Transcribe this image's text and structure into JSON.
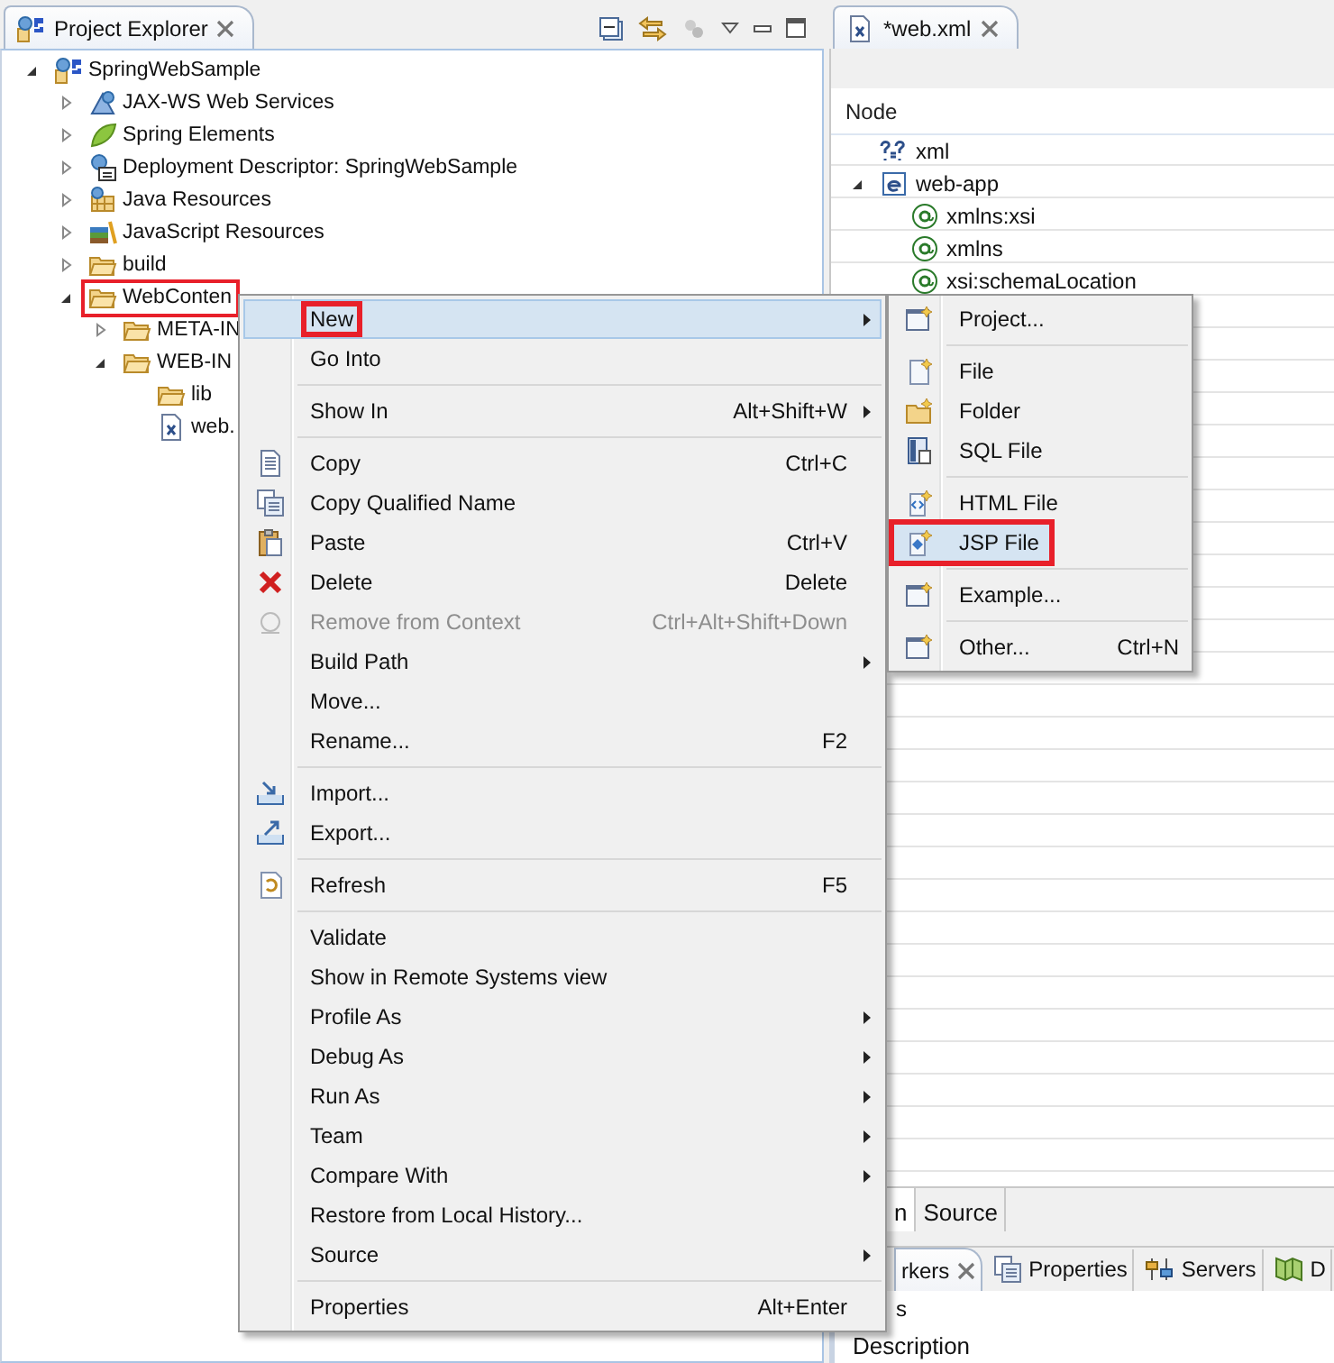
{
  "explorer": {
    "tab": {
      "title": "Project Explorer"
    },
    "tree": [
      {
        "label": "SpringWebSample",
        "kind": "project",
        "expanded": true,
        "marked": false,
        "children": [
          {
            "label": "JAX-WS Web Services",
            "kind": "service",
            "expanded": false,
            "marked": false
          },
          {
            "label": "Spring Elements",
            "kind": "spring",
            "expanded": false,
            "marked": false
          },
          {
            "label": "Deployment Descriptor: SpringWebSample",
            "kind": "descriptor",
            "expanded": false,
            "marked": false
          },
          {
            "label": "Java Resources",
            "kind": "java",
            "expanded": false,
            "marked": false
          },
          {
            "label": "JavaScript Resources",
            "kind": "script",
            "expanded": false,
            "marked": false
          },
          {
            "label": "build",
            "kind": "folder",
            "expanded": false,
            "marked": false
          },
          {
            "label": "WebConten",
            "kind": "folder",
            "expanded": true,
            "marked": true,
            "children": [
              {
                "label": "META-IN",
                "kind": "folder",
                "expanded": false,
                "marked": false
              },
              {
                "label": "WEB-IN",
                "kind": "folder",
                "expanded": true,
                "marked": false,
                "children": [
                  {
                    "label": "lib",
                    "kind": "folder",
                    "marked": false
                  },
                  {
                    "label": "web.",
                    "kind": "xml",
                    "marked": false
                  }
                ]
              }
            ]
          }
        ]
      }
    ]
  },
  "editor": {
    "tab": {
      "title": "*web.xml"
    },
    "column": "Node",
    "nodes": [
      {
        "label": "xml",
        "kind": "instruction"
      },
      {
        "label": "web-app",
        "kind": "element",
        "expanded": true,
        "children": [
          {
            "label": "xmlns:xsi",
            "kind": "attribute"
          },
          {
            "label": "xmlns",
            "kind": "attribute"
          },
          {
            "label": "xsi:schemaLocation",
            "kind": "attribute"
          }
        ]
      }
    ],
    "pages": [
      {
        "label": "n",
        "selected": true
      },
      {
        "label": "Source",
        "selected": false
      }
    ]
  },
  "views": {
    "tabs": [
      {
        "label": "rkers",
        "selected": true
      },
      {
        "label": "Properties",
        "selected": false
      },
      {
        "label": "Servers",
        "selected": false
      },
      {
        "label": "D",
        "selected": false
      }
    ],
    "summary": "s",
    "column": "Description"
  },
  "context_menu": [
    {
      "kind": "item",
      "label": "New",
      "submenu": true,
      "selected": true,
      "marked": true,
      "disabled": false
    },
    {
      "kind": "item",
      "label": "Go Into",
      "submenu": false,
      "selected": false,
      "marked": false,
      "disabled": false
    },
    {
      "kind": "separator"
    },
    {
      "kind": "item",
      "label": "Show In",
      "shortcut": "Alt+Shift+W",
      "submenu": true,
      "selected": false,
      "marked": false,
      "disabled": false
    },
    {
      "kind": "separator"
    },
    {
      "kind": "item",
      "label": "Copy",
      "shortcut": "Ctrl+C",
      "submenu": false,
      "selected": false,
      "marked": false,
      "disabled": false
    },
    {
      "kind": "item",
      "label": "Copy Qualified Name",
      "submenu": false,
      "selected": false,
      "marked": false,
      "disabled": false
    },
    {
      "kind": "item",
      "label": "Paste",
      "shortcut": "Ctrl+V",
      "submenu": false,
      "selected": false,
      "marked": false,
      "disabled": false
    },
    {
      "kind": "item",
      "label": "Delete",
      "shortcut": "Delete",
      "submenu": false,
      "selected": false,
      "marked": false,
      "disabled": false
    },
    {
      "kind": "item",
      "label": "Remove from Context",
      "shortcut": "Ctrl+Alt+Shift+Down",
      "submenu": false,
      "selected": false,
      "marked": false,
      "disabled": true
    },
    {
      "kind": "item",
      "label": "Build Path",
      "submenu": true,
      "selected": false,
      "marked": false,
      "disabled": false
    },
    {
      "kind": "item",
      "label": "Move...",
      "submenu": false,
      "selected": false,
      "marked": false,
      "disabled": false
    },
    {
      "kind": "item",
      "label": "Rename...",
      "shortcut": "F2",
      "submenu": false,
      "selected": false,
      "marked": false,
      "disabled": false
    },
    {
      "kind": "separator"
    },
    {
      "kind": "item",
      "label": "Import...",
      "submenu": false,
      "selected": false,
      "marked": false,
      "disabled": false
    },
    {
      "kind": "item",
      "label": "Export...",
      "submenu": false,
      "selected": false,
      "marked": false,
      "disabled": false
    },
    {
      "kind": "separator"
    },
    {
      "kind": "item",
      "label": "Refresh",
      "shortcut": "F5",
      "submenu": false,
      "selected": false,
      "marked": false,
      "disabled": false
    },
    {
      "kind": "separator"
    },
    {
      "kind": "item",
      "label": "Validate",
      "submenu": false,
      "selected": false,
      "marked": false,
      "disabled": false
    },
    {
      "kind": "item",
      "label": "Show in Remote Systems view",
      "submenu": false,
      "selected": false,
      "marked": false,
      "disabled": false
    },
    {
      "kind": "item",
      "label": "Profile As",
      "submenu": true,
      "selected": false,
      "marked": false,
      "disabled": false
    },
    {
      "kind": "item",
      "label": "Debug As",
      "submenu": true,
      "selected": false,
      "marked": false,
      "disabled": false
    },
    {
      "kind": "item",
      "label": "Run As",
      "submenu": true,
      "selected": false,
      "marked": false,
      "disabled": false
    },
    {
      "kind": "item",
      "label": "Team",
      "submenu": true,
      "selected": false,
      "marked": false,
      "disabled": false
    },
    {
      "kind": "item",
      "label": "Compare With",
      "submenu": true,
      "selected": false,
      "marked": false,
      "disabled": false
    },
    {
      "kind": "item",
      "label": "Restore from Local History...",
      "submenu": false,
      "selected": false,
      "marked": false,
      "disabled": false
    },
    {
      "kind": "item",
      "label": "Source",
      "submenu": true,
      "selected": false,
      "marked": false,
      "disabled": false
    },
    {
      "kind": "separator"
    },
    {
      "kind": "item",
      "label": "Properties",
      "shortcut": "Alt+Enter",
      "submenu": false,
      "selected": false,
      "marked": false,
      "disabled": false
    }
  ],
  "new_submenu": [
    {
      "kind": "item",
      "label": "Project...",
      "selected": false,
      "marked": false
    },
    {
      "kind": "separator"
    },
    {
      "kind": "item",
      "label": "File",
      "selected": false,
      "marked": false
    },
    {
      "kind": "item",
      "label": "Folder",
      "selected": false,
      "marked": false
    },
    {
      "kind": "item",
      "label": "SQL File",
      "selected": false,
      "marked": false
    },
    {
      "kind": "separator"
    },
    {
      "kind": "item",
      "label": "HTML File",
      "selected": false,
      "marked": false
    },
    {
      "kind": "item",
      "label": "JSP File",
      "selected": true,
      "marked": true
    },
    {
      "kind": "separator"
    },
    {
      "kind": "item",
      "label": "Example...",
      "selected": false,
      "marked": false
    },
    {
      "kind": "separator"
    },
    {
      "kind": "item",
      "label": "Other...",
      "shortcut": "Ctrl+N",
      "selected": false,
      "marked": false
    }
  ]
}
